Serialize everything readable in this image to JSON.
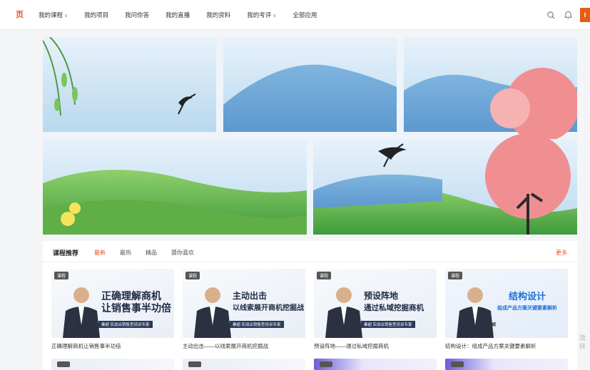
{
  "header": {
    "logo": "页",
    "nav": [
      {
        "label": "我的课程",
        "dropdown": true
      },
      {
        "label": "我的项目",
        "dropdown": false
      },
      {
        "label": "我问你答",
        "dropdown": false
      },
      {
        "label": "我的直播",
        "dropdown": false
      },
      {
        "label": "我的资料",
        "dropdown": false
      },
      {
        "label": "我的考评",
        "dropdown": true
      },
      {
        "label": "全部应用",
        "dropdown": false
      }
    ],
    "icons": [
      "search-icon",
      "bell-icon"
    ],
    "avatar_label": "I"
  },
  "section": {
    "title": "课程推荐",
    "tabs": [
      "最新",
      "最热",
      "精品",
      "猜你喜欢"
    ],
    "active_tab": "最新",
    "more": "更多"
  },
  "courses": [
    {
      "badge": "课程",
      "headline_1": "正确理解商机",
      "headline_2": "让销售事半功倍",
      "tag": "秦超  实战派销售型培训专家",
      "title": "正确理解商机让销售事半功倍"
    },
    {
      "badge": "课程",
      "headline_1": "主动出击",
      "headline_2": "以线索展开商机挖掘战",
      "tag": "秦超  实战派销售型培训专家",
      "title": "主动出击——以线索展开商机挖掘战"
    },
    {
      "badge": "课程",
      "headline_1": "预设阵地",
      "headline_2": "通过私域挖掘商机",
      "tag": "秦超  实战派销售型培训专家",
      "title": "预设阵地——通过私域挖掘商机"
    },
    {
      "badge": "课程",
      "headline_1": "结构设计",
      "headline_2": "组成产品方案关键要素解析",
      "tag": "秦超",
      "title": "结构设计：组成产品方案关键要素解析"
    }
  ],
  "watermark": [
    "激",
    "转"
  ],
  "colors": {
    "accent": "#e8522b",
    "avatar": "#e85c12"
  }
}
